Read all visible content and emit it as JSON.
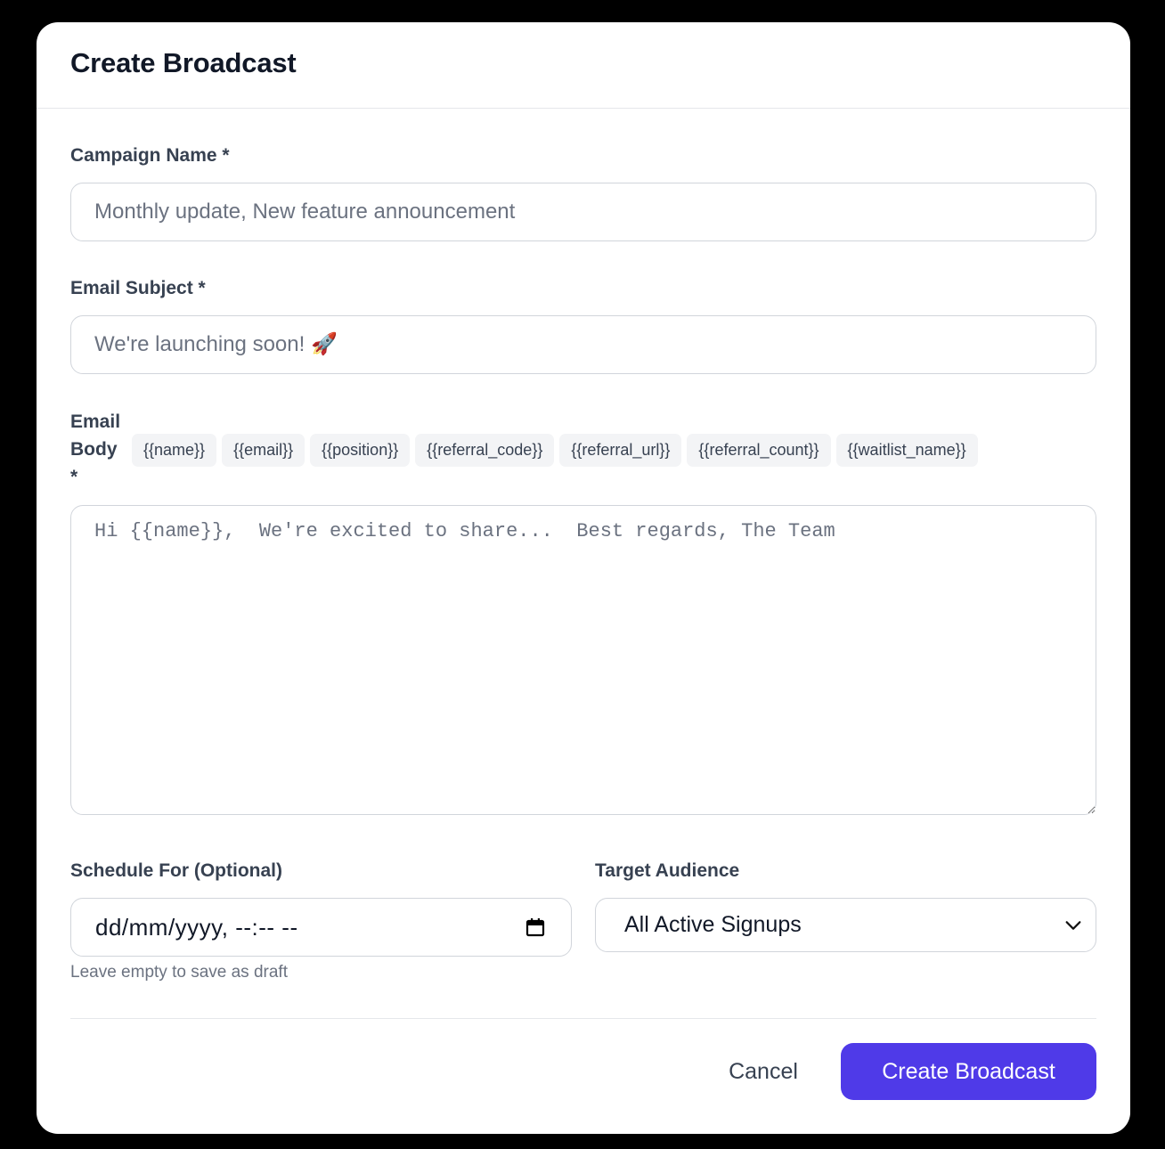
{
  "modal": {
    "title": "Create Broadcast"
  },
  "campaign_name": {
    "label": "Campaign Name *",
    "placeholder": "Monthly update, New feature announcement",
    "value": ""
  },
  "email_subject": {
    "label": "Email Subject *",
    "placeholder": "We're launching soon! 🚀",
    "value": ""
  },
  "email_body": {
    "label_line1": "Email",
    "label_line2": "Body",
    "label_line3": "*",
    "variables": [
      "{{name}}",
      "{{email}}",
      "{{position}}",
      "{{referral_code}}",
      "{{referral_url}}",
      "{{referral_count}}",
      "{{waitlist_name}}"
    ],
    "placeholder": "Hi {{name}},  We're excited to share...  Best regards, The Team",
    "value": ""
  },
  "schedule": {
    "label": "Schedule For (Optional)",
    "value": "dd/mm/yyyy, --:-- --",
    "hint": "Leave empty to save as draft",
    "icon": "calendar-icon"
  },
  "audience": {
    "label": "Target Audience",
    "selected": "All Active Signups",
    "icon": "chevron-down-icon"
  },
  "footer": {
    "cancel_label": "Cancel",
    "submit_label": "Create Broadcast"
  },
  "colors": {
    "accent": "#4f3ae8",
    "backdrop": "#000000",
    "chip_bg": "#f3f4f6"
  }
}
